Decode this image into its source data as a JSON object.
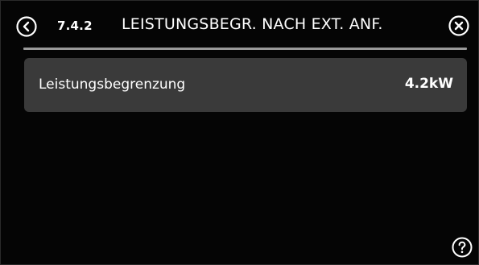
{
  "header": {
    "menu_number": "7.4.2",
    "title": "LEISTUNGSBEGR. NACH EXT. ANF.",
    "back_icon": "chevron-left-circle",
    "close_icon": "close-circle"
  },
  "settings": [
    {
      "label": "Leistungsbegrenzung",
      "value": "4.2kW"
    }
  ],
  "footer": {
    "help_icon": "question-circle"
  },
  "colors": {
    "background": "#050505",
    "row_background": "#3a3a3a",
    "divider": "#9a9a9a",
    "text": "#ffffff"
  }
}
